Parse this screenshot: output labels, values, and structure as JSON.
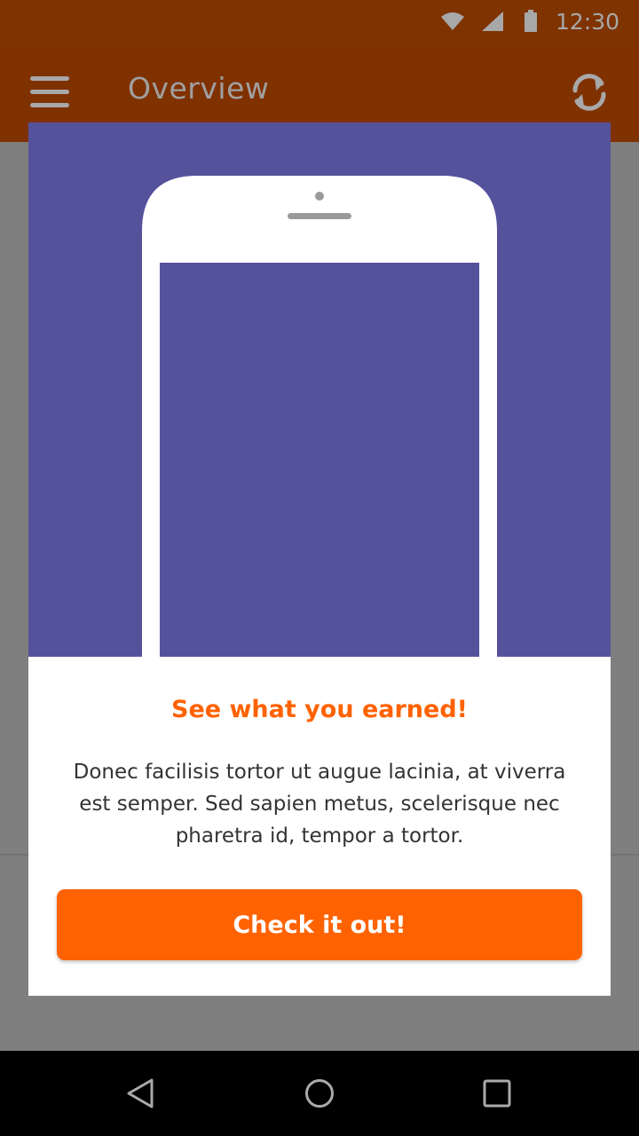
{
  "status_bar": {
    "time": "12:30"
  },
  "app_bar": {
    "title": "Overview"
  },
  "dialog": {
    "heading": "See what you earned!",
    "body": "Donec facilisis tortor ut augue lacinia, at viverra est semper. Sed sapien metus, scelerisque nec pharetra id, tempor a tortor.",
    "button_label": "Check it out!"
  },
  "colors": {
    "brand_orange": "#ff6200",
    "illustration_purple": "#55529c",
    "status_bar": "#7e3300",
    "scrim": "#808080",
    "nav_bar": "#000000"
  },
  "icons": {
    "status": [
      "wifi-icon",
      "signal-icon",
      "battery-icon"
    ],
    "app_bar": [
      "menu-icon",
      "refresh-icon"
    ],
    "nav": [
      "back-icon",
      "home-icon",
      "recents-icon"
    ]
  }
}
